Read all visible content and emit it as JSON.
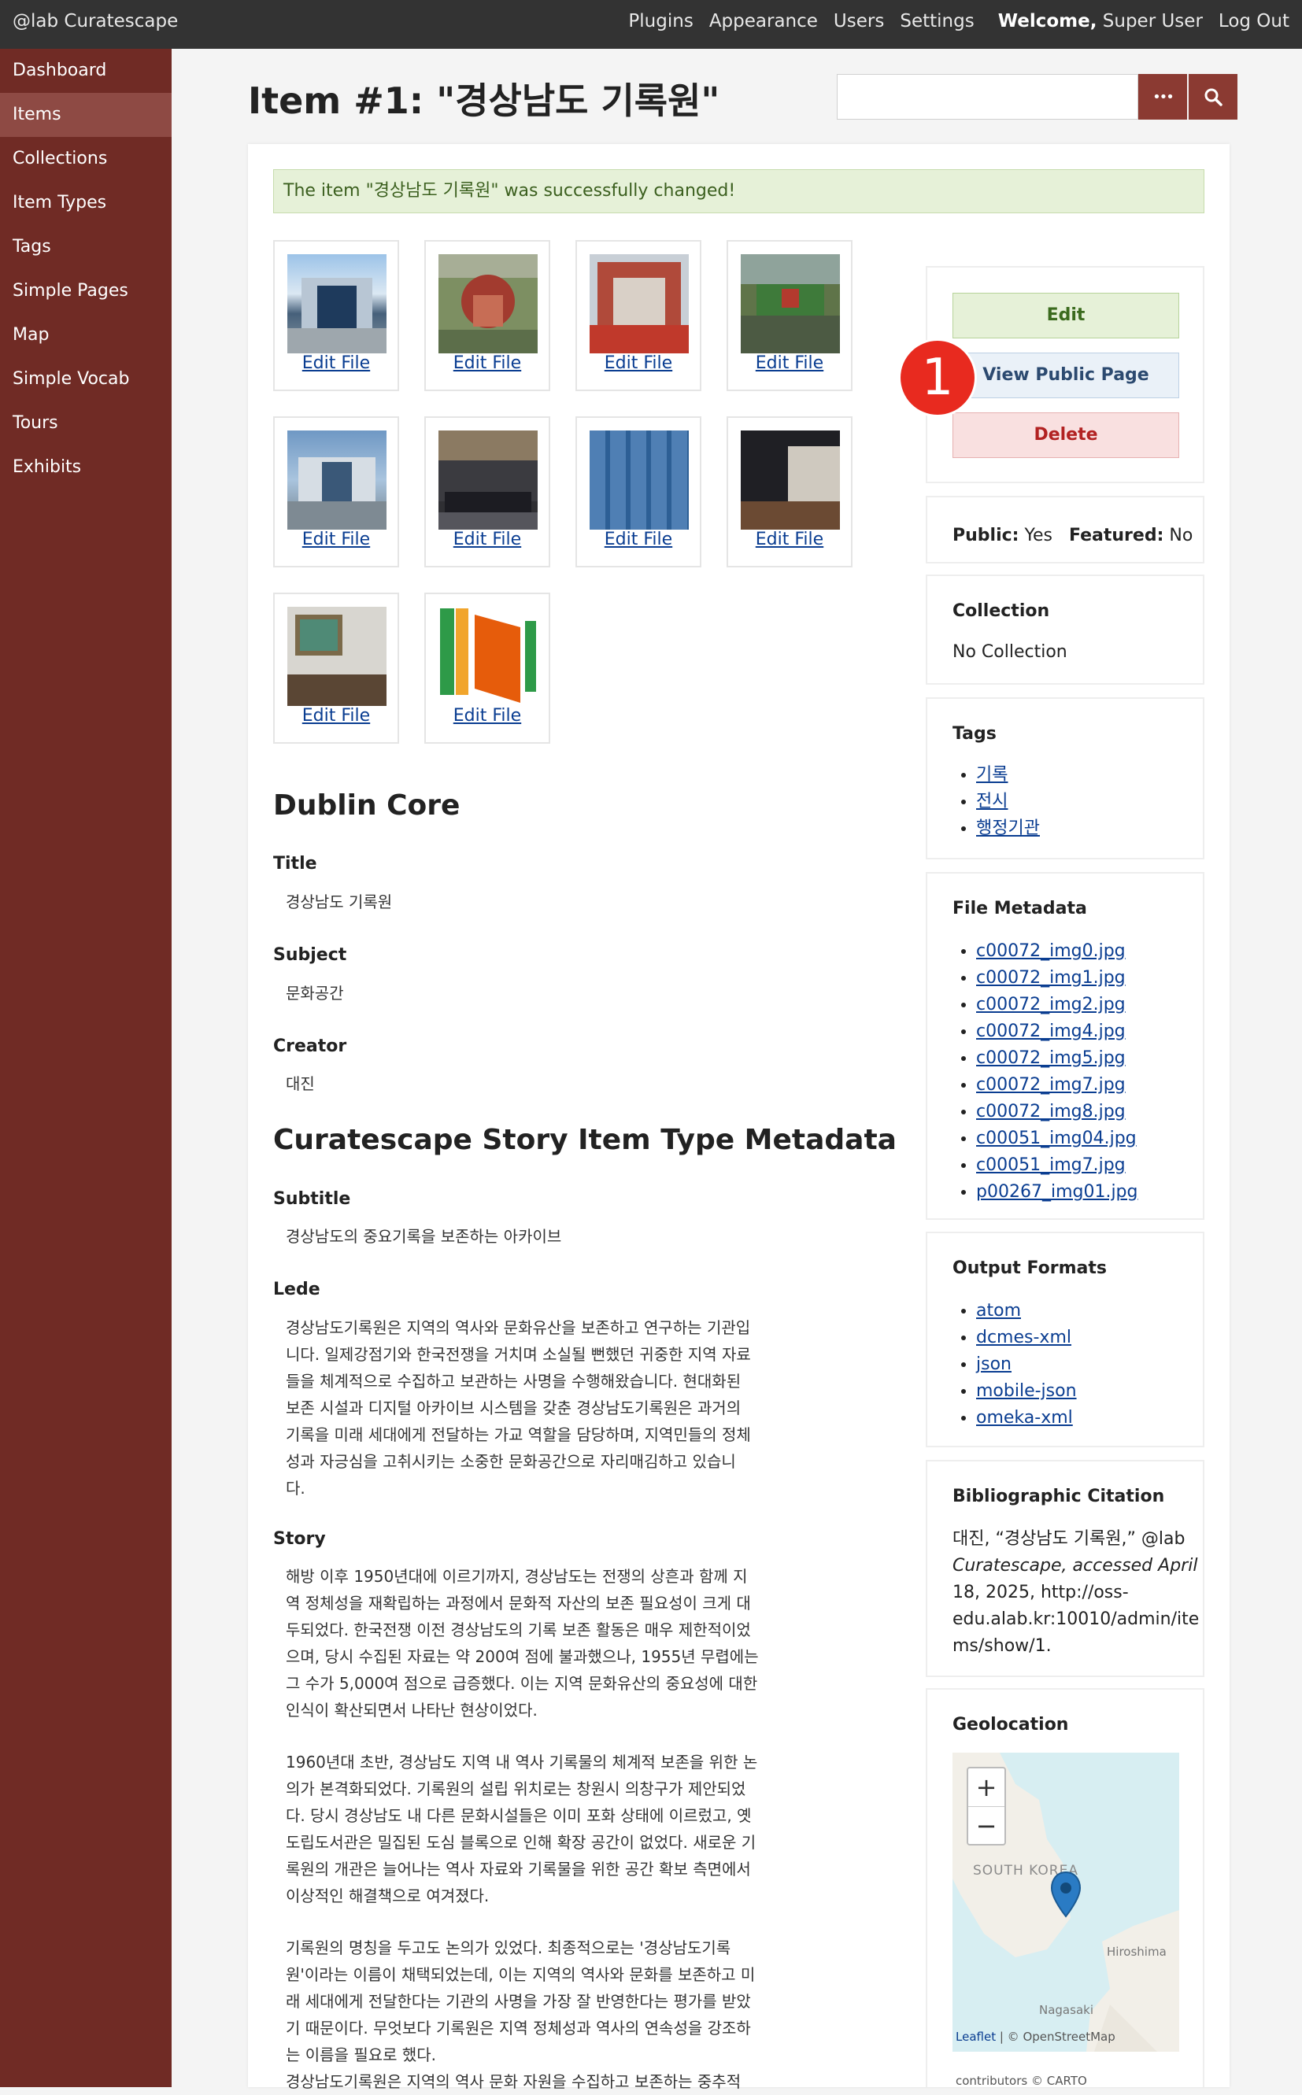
{
  "topbar": {
    "brand": "@lab Curatescape",
    "nav": [
      "Plugins",
      "Appearance",
      "Users",
      "Settings"
    ],
    "welcome_prefix": "Welcome,",
    "welcome_user": "Super User",
    "logout": "Log Out"
  },
  "sidebar": {
    "items": [
      {
        "label": "Dashboard"
      },
      {
        "label": "Items"
      },
      {
        "label": "Collections"
      },
      {
        "label": "Item Types"
      },
      {
        "label": "Tags"
      },
      {
        "label": "Simple Pages"
      },
      {
        "label": "Map"
      },
      {
        "label": "Simple Vocab"
      },
      {
        "label": "Tours"
      },
      {
        "label": "Exhibits"
      }
    ],
    "active_index": 1
  },
  "page_title": "Item #1: \"경상남도 기록원\"",
  "search": {
    "more_icon": "•••",
    "search_icon": "search-icon"
  },
  "flash": "The item \"경상남도 기록원\" was successfully changed!",
  "files": {
    "edit_label": "Edit File",
    "count": 10
  },
  "dublin_core": {
    "heading": "Dublin Core",
    "fields": [
      {
        "label": "Title",
        "value": "경상남도 기록원"
      },
      {
        "label": "Subject",
        "value": "문화공간"
      },
      {
        "label": "Creator",
        "value": "대진"
      }
    ]
  },
  "story_meta": {
    "heading": "Curatescape Story Item Type Metadata",
    "subtitle_label": "Subtitle",
    "subtitle": "경상남도의 중요기록을 보존하는 아카이브",
    "lede_label": "Lede",
    "lede_lines": [
      "경상남도기록원은 지역의 역사와 문화유산을 보존하고 연구하는 기관입",
      "니다. 일제강점기와 한국전쟁을 거치며 소실될 뻔했던 귀중한 지역 자료",
      "들을 체계적으로 수집하고 보관하는 사명을 수행해왔습니다. 현대화된",
      "보존 시설과 디지털 아카이브 시스템을 갖춘 경상남도기록원은 과거의",
      "기록을 미래 세대에게 전달하는 가교 역할을 담당하며, 지역민들의 정체",
      "성과 자긍심을 고취시키는 소중한 문화공간으로 자리매김하고 있습니",
      "다."
    ],
    "story_label": "Story",
    "story_p1": [
      "해방 이후 1950년대에 이르기까지, 경상남도는 전쟁의 상흔과 함께 지",
      "역 정체성을 재확립하는 과정에서 문화적 자산의 보존 필요성이 크게 대",
      "두되었다. 한국전쟁 이전 경상남도의 기록 보존 활동은 매우 제한적이었",
      "으며, 당시 수집된 자료는 약 200여 점에 불과했으나, 1955년 무렵에는",
      "그 수가 5,000여 점으로 급증했다. 이는 지역 문화유산의 중요성에 대한",
      "인식이 확산되면서 나타난 현상이었다."
    ],
    "story_p2": [
      "1960년대 초반, 경상남도 지역 내 역사 기록물의 체계적 보존을 위한 논",
      "의가 본격화되었다. 기록원의 설립 위치로는 창원시 의창구가 제안되었",
      "다. 당시 경상남도 내 다른 문화시설들은 이미 포화 상태에 이르렀고, 옛",
      "도립도서관은 밀집된 도심 블록으로 인해 확장 공간이 없었다. 새로운 기",
      "록원의 개관은 늘어나는 역사 자료와 기록물을 위한 공간 확보 측면에서",
      "이상적인 해결책으로 여겨졌다."
    ],
    "story_p3": [
      "기록원의 명칭을 두고도 논의가 있었다. 최종적으로는 '경상남도기록",
      "원'이라는 이름이 채택되었는데, 이는 지역의 역사와 문화를 보존하고 미",
      "래 세대에게 전달한다는 기관의 사명을 가장 잘 반영한다는 평가를 받았",
      "기 때문이다. 무엇보다 기록원은 지역 정체성과 역사의 연속성을 강조하",
      "는 이름을 필요로 했다.",
      "경상남도기록원은 지역의 역사 문화 자원을 수집하고 보존하는 중추적"
    ]
  },
  "actions": {
    "edit": "Edit",
    "view": "View Public Page",
    "delete": "Delete",
    "badge": "1"
  },
  "status": {
    "public_label": "Public:",
    "public_value": "Yes",
    "featured_label": "Featured:",
    "featured_value": "No"
  },
  "collection": {
    "title": "Collection",
    "value": "No Collection"
  },
  "tags": {
    "title": "Tags",
    "items": [
      "기록",
      "전시",
      "행정기관"
    ]
  },
  "file_metadata": {
    "title": "File Metadata",
    "items": [
      "c00072_img0.jpg",
      "c00072_img1.jpg",
      "c00072_img2.jpg",
      "c00072_img4.jpg",
      "c00072_img5.jpg",
      "c00072_img7.jpg",
      "c00072_img8.jpg",
      "c00051_img04.jpg",
      "c00051_img7.jpg",
      "p00267_img01.jpg"
    ]
  },
  "output_formats": {
    "title": "Output Formats",
    "items": [
      "atom",
      "dcmes-xml",
      "json",
      "mobile-json",
      "omeka-xml"
    ]
  },
  "citation": {
    "title": "Bibliographic Citation",
    "lines": [
      "대진, “경상남도 기록원,” @lab",
      "Curatescape, accessed April",
      "18, 2025, http://oss-",
      "edu.alab.kr:10010/admin/ite",
      "ms/show/1."
    ]
  },
  "geolocation": {
    "title": "Geolocation",
    "zoom_in": "+",
    "zoom_out": "−",
    "labels": {
      "korea": "SOUTH KOREA",
      "hiroshima": "Hiroshima",
      "nagasaki": "Nagasaki",
      "leaflet": "Leaflet",
      "credits": "| © OpenStreetMap",
      "credits2": "contributors © CARTO"
    }
  }
}
